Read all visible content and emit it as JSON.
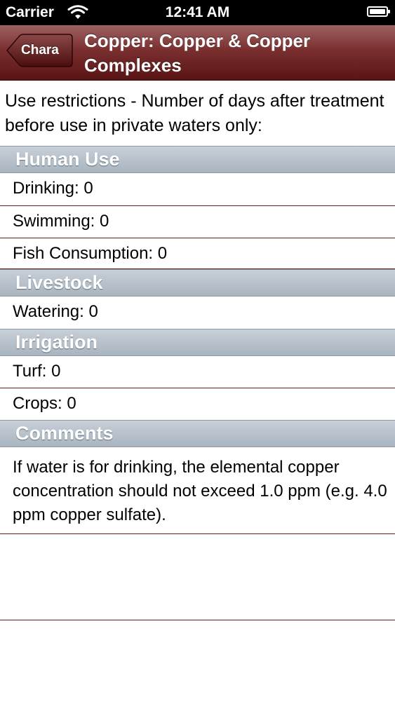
{
  "status_bar": {
    "carrier": "Carrier",
    "time": "12:41 AM"
  },
  "nav": {
    "back_label": "Chara",
    "title": "Copper: Copper & Copper Complexes"
  },
  "intro": "Use restrictions - Number of days after treatment before use in private waters only:",
  "sections": {
    "human_use": {
      "title": "Human Use",
      "rows": [
        "Drinking: 0",
        "Swimming: 0",
        "Fish Consumption: 0"
      ]
    },
    "livestock": {
      "title": "Livestock",
      "rows": [
        "Watering: 0"
      ]
    },
    "irrigation": {
      "title": "Irrigation",
      "rows": [
        "Turf: 0",
        "Crops: 0"
      ]
    },
    "comments": {
      "title": "Comments",
      "text": "If water is for drinking, the elemental copper concentration should not exceed 1.0 ppm (e.g. 4.0 ppm copper sulfate)."
    }
  }
}
